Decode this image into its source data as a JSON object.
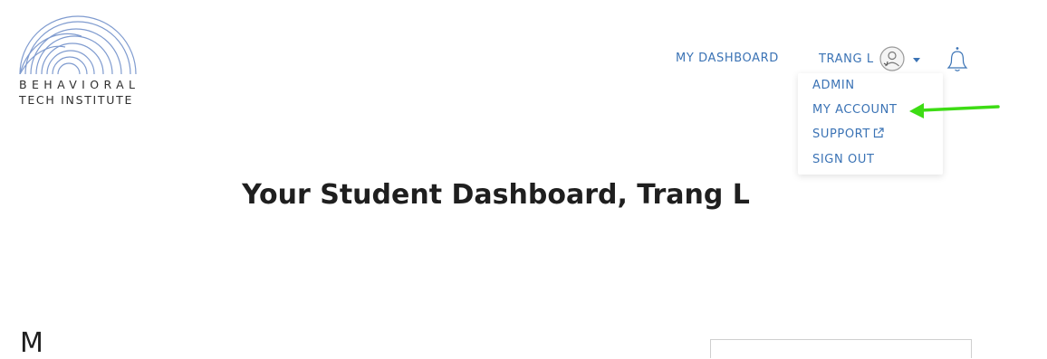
{
  "logo": {
    "line1": "BEHAVIORAL",
    "line2": "TECH INSTITUTE",
    "arc_color": "#7f9bcf"
  },
  "nav": {
    "dashboard_label": "MY DASHBOARD",
    "user_label": "TRANG L",
    "link_color": "#3b73b5"
  },
  "dropdown": {
    "items": [
      {
        "label": "ADMIN"
      },
      {
        "label": "MY ACCOUNT"
      },
      {
        "label": "SUPPORT",
        "icon": "external-link-icon"
      },
      {
        "label": "SIGN OUT"
      }
    ]
  },
  "annotation": {
    "arrow_color": "#3ddc14"
  },
  "main": {
    "title": "Your Student Dashboard, Trang L",
    "section_heading_partial": "M"
  }
}
